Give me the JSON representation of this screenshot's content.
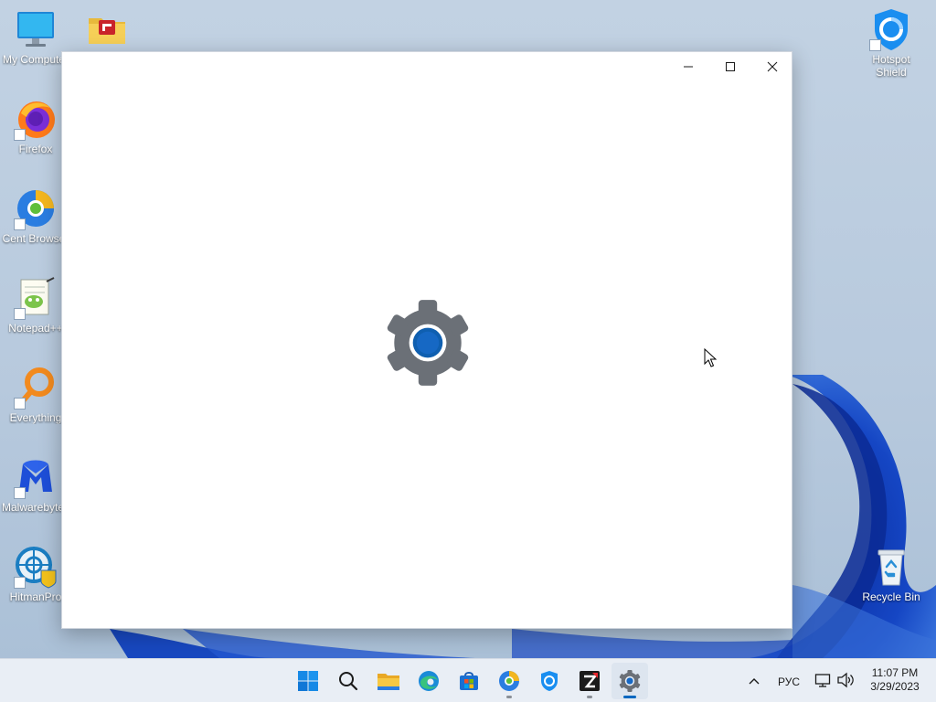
{
  "desktop": {
    "icons": [
      {
        "label": "My Computer",
        "icon": "monitor-icon"
      },
      {
        "label": "",
        "icon": "folder-app-icon"
      },
      {
        "label": "Firefox",
        "icon": "firefox-icon"
      },
      {
        "label": "Cent Browser",
        "icon": "cent-browser-icon"
      },
      {
        "label": "Notepad++",
        "icon": "notepadpp-icon"
      },
      {
        "label": "Everything",
        "icon": "everything-search-icon"
      },
      {
        "label": "Malwarebytes",
        "icon": "malwarebytes-icon"
      },
      {
        "label": "HitmanPro",
        "icon": "hitmanpro-icon"
      },
      {
        "label": "Hotspot Shield",
        "icon": "hotspot-shield-icon"
      },
      {
        "label": "Recycle Bin",
        "icon": "recycle-bin-icon"
      }
    ]
  },
  "window": {
    "splash_icon": "settings-gear-icon",
    "controls": [
      "minimize-icon",
      "maximize-icon",
      "close-icon"
    ]
  },
  "taskbar": {
    "apps": [
      {
        "icon": "windows-start-icon",
        "running": false,
        "active": false
      },
      {
        "icon": "search-icon",
        "running": false,
        "active": false
      },
      {
        "icon": "file-explorer-icon",
        "running": false,
        "active": false
      },
      {
        "icon": "edge-icon",
        "running": false,
        "active": false
      },
      {
        "icon": "store-icon",
        "running": false,
        "active": false
      },
      {
        "icon": "cent-browser-icon",
        "running": true,
        "active": false
      },
      {
        "icon": "hotspot-shield-icon",
        "running": false,
        "active": false
      },
      {
        "icon": "zoner-icon",
        "running": true,
        "active": false
      },
      {
        "icon": "settings-icon",
        "running": true,
        "active": true
      }
    ],
    "tray": {
      "language": "РУС",
      "time": "11:07 PM",
      "date": "3/29/2023"
    }
  },
  "colors": {
    "accent": "#0067c0",
    "wallpaper_light": "#c2d2e3",
    "wallpaper_bloom": "#1840b8",
    "gear": "#6b7077"
  }
}
